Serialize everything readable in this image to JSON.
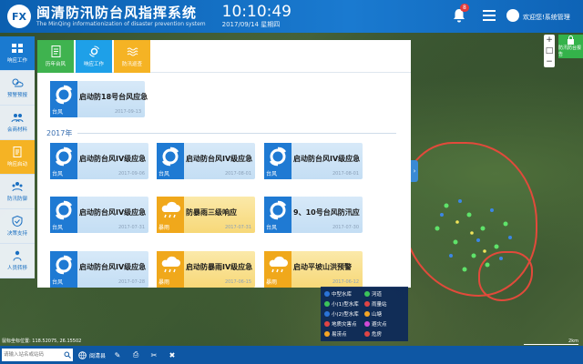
{
  "header": {
    "title": "闽清防汛防台风指挥系统",
    "subtitle": "The MinQing informationization of disaster prevention system",
    "time": "10:10:49",
    "date": "2017/09/14 星期四",
    "notifications": "8",
    "welcome": "欢迎您!系统管理"
  },
  "leftnav": [
    {
      "label": "响应工作",
      "icon": "grid-icon"
    },
    {
      "label": "预警预报",
      "icon": "weather-icon"
    },
    {
      "label": "会商材料",
      "icon": "people-icon"
    },
    {
      "label": "响应启动",
      "icon": "document-icon"
    },
    {
      "label": "防汛防御",
      "icon": "team-icon"
    },
    {
      "label": "决策支持",
      "icon": "shield-icon"
    },
    {
      "label": "人员转移",
      "icon": "person-icon"
    }
  ],
  "subtabs": [
    {
      "label": "历年台风",
      "color": "#3fb34f"
    },
    {
      "label": "响应工作",
      "color": "#1ea0e8"
    },
    {
      "label": "防汛巡查",
      "color": "#f5b324"
    }
  ],
  "year": "2017年",
  "featured": {
    "title": "启动防18号台风应急",
    "cat": "台风",
    "date": "2017-09-13"
  },
  "cards": [
    {
      "title": "启动防台风IV级应急",
      "cat": "台风",
      "date": "2017-09-06",
      "kind": "typhoon"
    },
    {
      "title": "启动防台风IV级应急",
      "cat": "台风",
      "date": "2017-08-01",
      "kind": "typhoon"
    },
    {
      "title": "启动防台风IV级应急",
      "cat": "台风",
      "date": "2017-08-01",
      "kind": "typhoon"
    },
    {
      "title": "启动防台风IV级应急",
      "cat": "台风",
      "date": "2017-07-31",
      "kind": "typhoon"
    },
    {
      "title": "防暴雨三级响应",
      "cat": "暴雨",
      "date": "2017-07-31",
      "kind": "rain"
    },
    {
      "title": "9、10号台风防汛应",
      "cat": "台风",
      "date": "2017-07-30",
      "kind": "typhoon"
    },
    {
      "title": "启动防台风IV级应急",
      "cat": "台风",
      "date": "2017-07-28",
      "kind": "typhoon"
    },
    {
      "title": "启动防暴雨IV级应急",
      "cat": "暴雨",
      "date": "2017-06-15",
      "kind": "rain"
    },
    {
      "title": "启动平坡山洪预警",
      "cat": "暴雨",
      "date": "2017-06-12",
      "kind": "rain"
    }
  ],
  "legend": [
    [
      "中型水库",
      "河道"
    ],
    [
      "小(1)型水库",
      "雨量站"
    ],
    [
      "小(2)型水库",
      "山塘"
    ],
    [
      "地质灾害点",
      "避灾点"
    ],
    [
      "易涝点",
      "危房"
    ]
  ],
  "legend_colors": [
    "#2b74d8",
    "#3cc45a",
    "#3cc45a",
    "#e04444",
    "#2b74d8",
    "#f5a524",
    "#e04444",
    "#d24ad6",
    "#f5a524",
    "#e04444"
  ],
  "map": {
    "right_button": "防汛防台报告"
  },
  "bottom": {
    "search_placeholder": "请输入站名或站码",
    "location": "闽清县",
    "coords": "鼠标坐标位置: 118.52075, 26.15502"
  }
}
